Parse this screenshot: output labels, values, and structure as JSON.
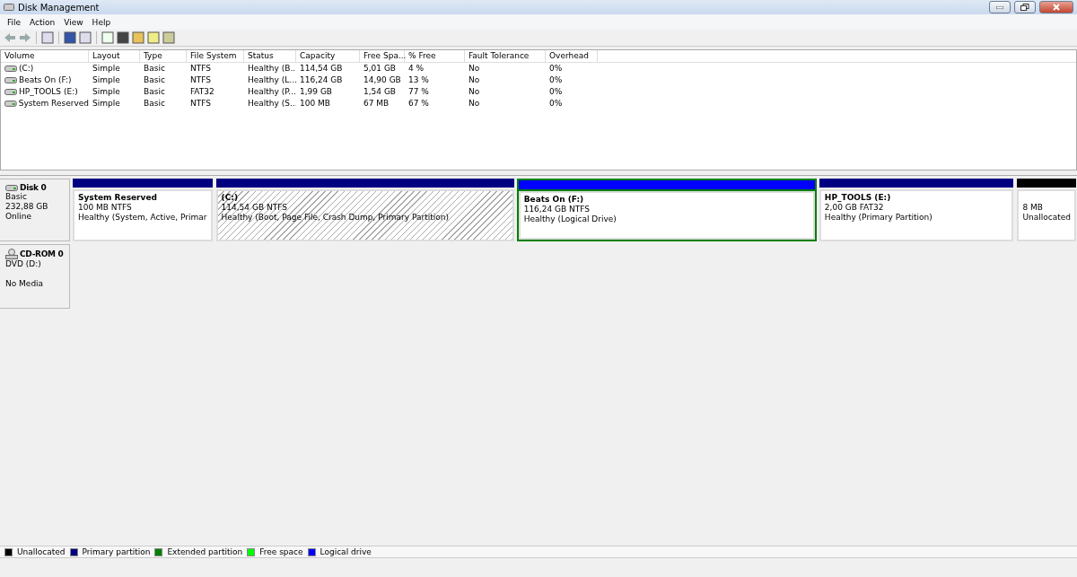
{
  "window": {
    "title": "Disk Management"
  },
  "menu": [
    "File",
    "Action",
    "View",
    "Help"
  ],
  "table": {
    "columns": [
      "Volume",
      "Layout",
      "Type",
      "File System",
      "Status",
      "Capacity",
      "Free Spa...",
      "% Free",
      "Fault Tolerance",
      "Overhead"
    ],
    "rows": [
      {
        "cells": [
          "(C:)",
          "Simple",
          "Basic",
          "NTFS",
          "Healthy (B...",
          "114,54 GB",
          "5,01 GB",
          "4 %",
          "No",
          "0%"
        ]
      },
      {
        "cells": [
          "Beats On (F:)",
          "Simple",
          "Basic",
          "NTFS",
          "Healthy (L...",
          "116,24 GB",
          "14,90 GB",
          "13 %",
          "No",
          "0%"
        ]
      },
      {
        "cells": [
          "HP_TOOLS (E:)",
          "Simple",
          "Basic",
          "FAT32",
          "Healthy (P...",
          "1,99 GB",
          "1,54 GB",
          "77 %",
          "No",
          "0%"
        ]
      },
      {
        "cells": [
          "System Reserved",
          "Simple",
          "Basic",
          "NTFS",
          "Healthy (S...",
          "100 MB",
          "67 MB",
          "67 %",
          "No",
          "0%"
        ]
      }
    ]
  },
  "disks": [
    {
      "kind": "disk",
      "name": "Disk 0",
      "type": "Basic",
      "size": "232,88 GB",
      "status": "Online",
      "partitions": [
        {
          "kind": "primary",
          "selected": false,
          "title": "System Reserved",
          "size": "100 MB NTFS",
          "status": "Healthy (System, Active, Primar"
        },
        {
          "kind": "primary",
          "selected": true,
          "title": "(C:)",
          "size": "114,54 GB NTFS",
          "status": "Healthy (Boot, Page File, Crash Dump, Primary Partition)"
        },
        {
          "kind": "logical",
          "selected": false,
          "title": "Beats On  (F:)",
          "size": "116,24 GB NTFS",
          "status": "Healthy (Logical Drive)"
        },
        {
          "kind": "primary",
          "selected": false,
          "title": "HP_TOOLS  (E:)",
          "size": "2,00 GB FAT32",
          "status": "Healthy (Primary Partition)"
        },
        {
          "kind": "unallocated",
          "selected": false,
          "size": "8 MB",
          "status": "Unallocated"
        }
      ]
    },
    {
      "kind": "cdrom",
      "name": "CD-ROM 0",
      "type": "DVD (D:)",
      "status": "No Media"
    }
  ],
  "legend": [
    {
      "label": "Unallocated",
      "color": "#000000"
    },
    {
      "label": "Primary partition",
      "color": "#000080"
    },
    {
      "label": "Extended partition",
      "color": "#008000"
    },
    {
      "label": "Free space",
      "color": "#00ff00"
    },
    {
      "label": "Logical drive",
      "color": "#0000ff"
    }
  ]
}
